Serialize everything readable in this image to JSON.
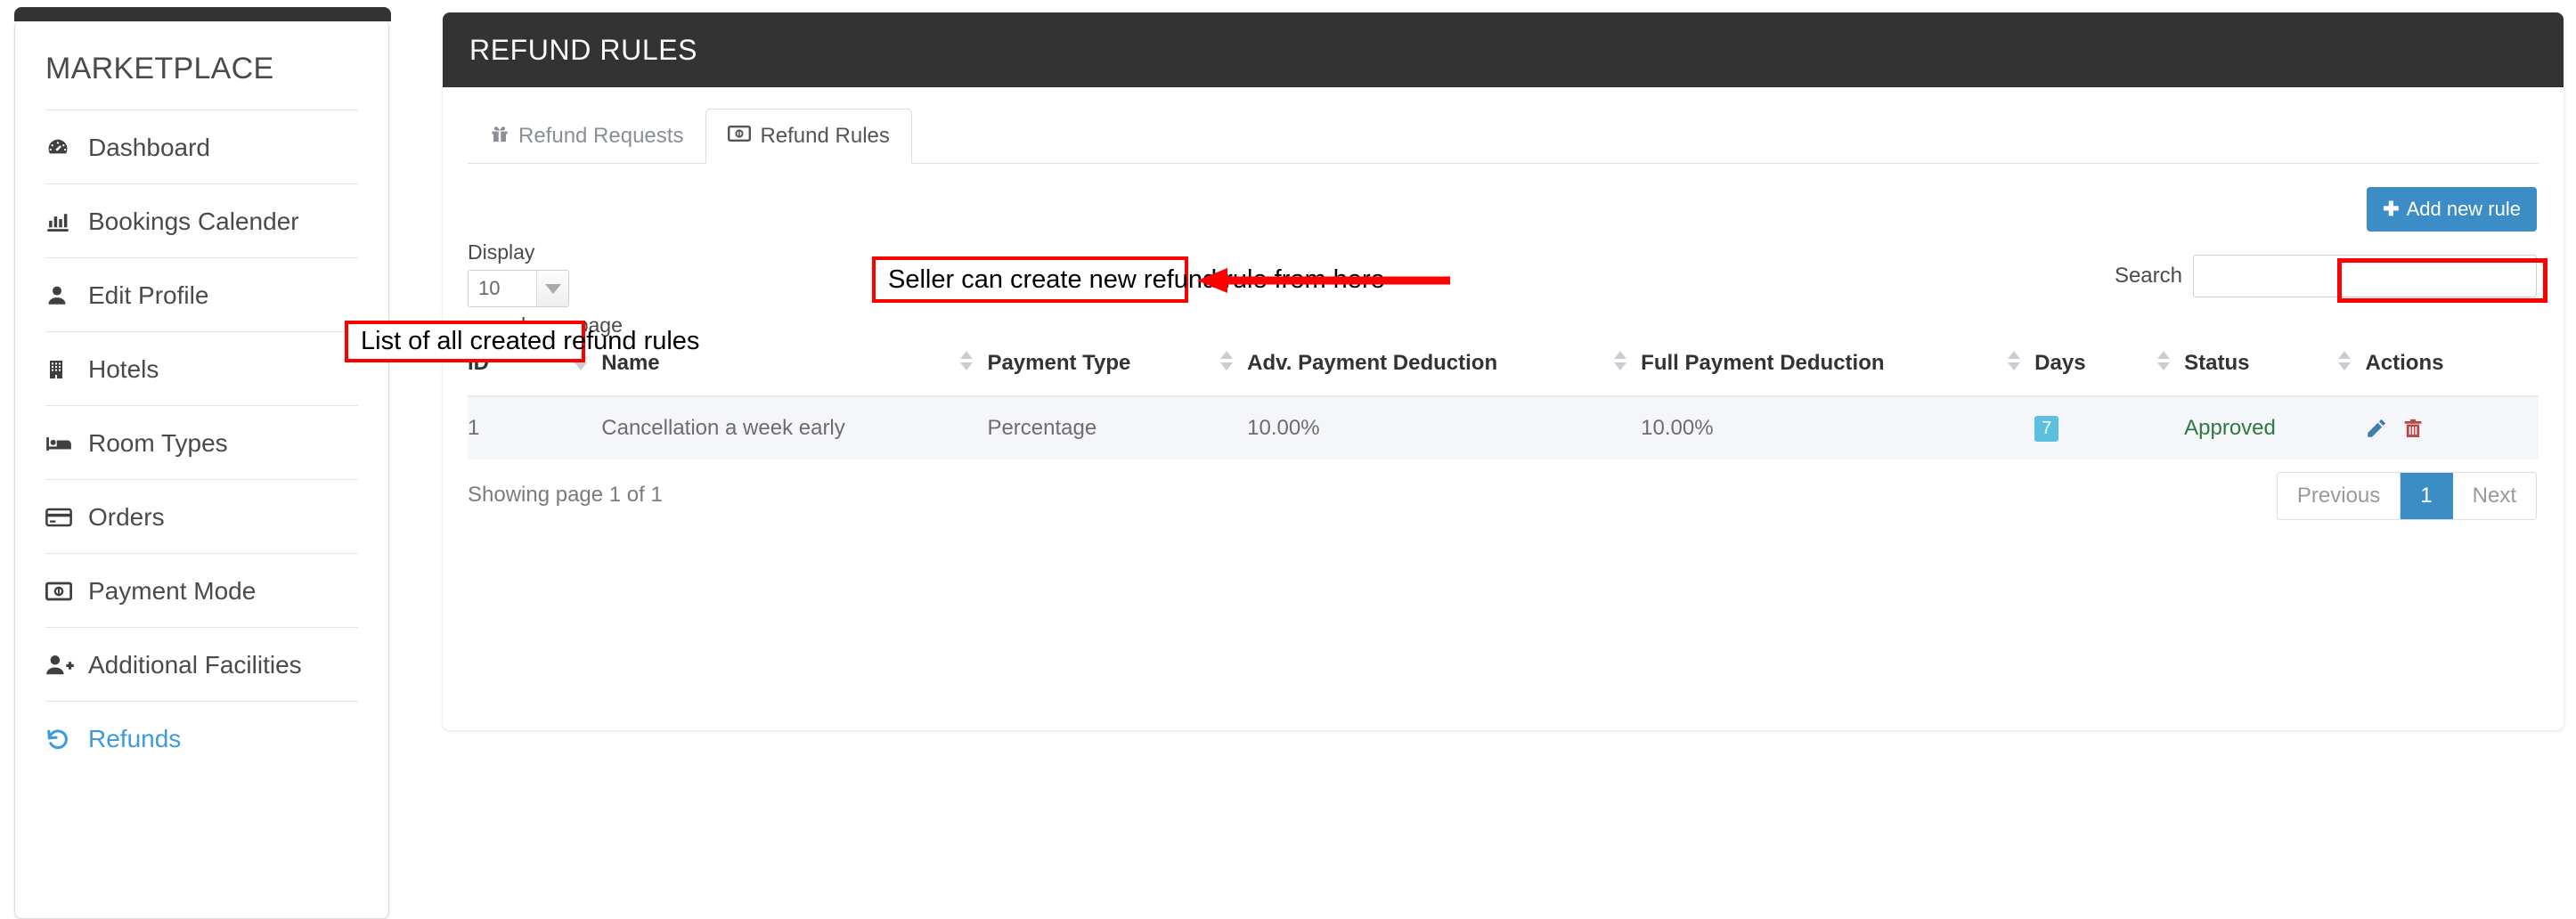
{
  "sidebar": {
    "brand": "MARKETPLACE",
    "items": [
      {
        "label": "Dashboard",
        "icon": "dashboard-icon",
        "active": false
      },
      {
        "label": "Bookings Calender",
        "icon": "bar-chart-icon",
        "active": false
      },
      {
        "label": "Edit Profile",
        "icon": "user-icon",
        "active": false
      },
      {
        "label": "Hotels",
        "icon": "building-icon",
        "active": false
      },
      {
        "label": "Room Types",
        "icon": "bed-icon",
        "active": false
      },
      {
        "label": "Orders",
        "icon": "credit-card-icon",
        "active": false
      },
      {
        "label": "Payment Mode",
        "icon": "money-bill-icon",
        "active": false
      },
      {
        "label": "Additional Facilities",
        "icon": "user-plus-icon",
        "active": false
      },
      {
        "label": "Refunds",
        "icon": "undo-arrow-icon",
        "active": true
      }
    ]
  },
  "panel": {
    "title": "REFUND RULES"
  },
  "tabs": [
    {
      "label": "Refund Requests",
      "icon": "gift-icon",
      "active": false
    },
    {
      "label": "Refund Rules",
      "icon": "money-bill-icon",
      "active": true
    }
  ],
  "toolbar": {
    "add_new_rule_label": "Add new rule",
    "add_icon": "plus-icon"
  },
  "filters": {
    "display_label": "Display",
    "records_label": "records per page",
    "page_size_value": "10",
    "search_label": "Search",
    "search_value": "",
    "search_placeholder": ""
  },
  "table": {
    "columns": [
      {
        "label": "ID",
        "sortable": true
      },
      {
        "label": "Name",
        "sortable": true
      },
      {
        "label": "Payment Type",
        "sortable": true
      },
      {
        "label": "Adv. Payment Deduction",
        "sortable": true
      },
      {
        "label": "Full Payment Deduction",
        "sortable": true
      },
      {
        "label": "Days",
        "sortable": true
      },
      {
        "label": "Status",
        "sortable": true
      },
      {
        "label": "Actions",
        "sortable": false
      }
    ],
    "rows": [
      {
        "id": "1",
        "name": "Cancellation a week early",
        "payment_type": "Percentage",
        "adv_payment_deduction": "10.00%",
        "full_payment_deduction": "10.00%",
        "days": "7",
        "status": "Approved",
        "actions": [
          "edit-pencil-icon",
          "delete-trash-icon"
        ]
      }
    ]
  },
  "footer": {
    "showing": "Showing page 1 of 1",
    "previous_label": "Previous",
    "page_number": "1",
    "next_label": "Next"
  },
  "annotations": [
    {
      "text": "Seller can create new refund rule from here"
    },
    {
      "text": "List of all created refund rules"
    }
  ],
  "colors": {
    "header_bg": "#333333",
    "accent_blue": "#3c8dc5",
    "link_blue": "#3c9ade",
    "badge_cyan": "#5bc0de",
    "status_green": "#2d7a3e",
    "annotation_red": "#ff0000",
    "row_bg": "#f5f6fa"
  }
}
